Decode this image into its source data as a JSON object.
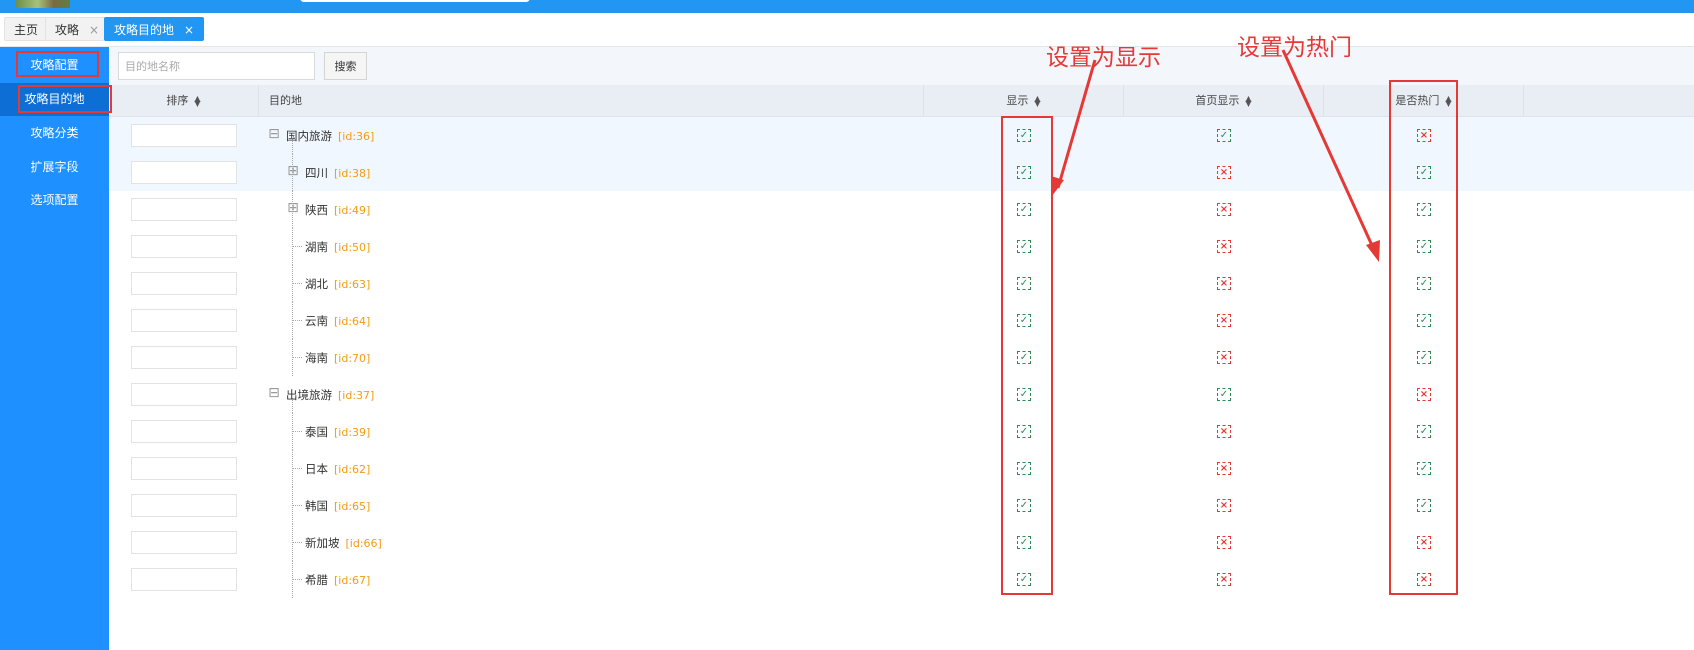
{
  "tabs": [
    {
      "label": "主页",
      "closable": false
    },
    {
      "label": "攻略",
      "closable": true,
      "close": "×"
    },
    {
      "label": "攻略目的地",
      "closable": true,
      "close": "×"
    }
  ],
  "sidebar": {
    "items": [
      {
        "label": "攻略配置"
      },
      {
        "label": "攻略目的地"
      },
      {
        "label": "攻略分类"
      },
      {
        "label": "扩展字段"
      },
      {
        "label": "选项配置"
      }
    ]
  },
  "search": {
    "placeholder": "目的地名称",
    "button_label": "搜索"
  },
  "table": {
    "headers": {
      "order": "排序",
      "destination": "目的地",
      "display": "显示",
      "home_display": "首页显示",
      "hot": "是否热门"
    },
    "rows": [
      {
        "name": "国内旅游",
        "id": "[id:36]",
        "toggle": "⊟",
        "display": true,
        "home": true,
        "hot": false
      },
      {
        "name": "四川",
        "id": "[id:38]",
        "toggle": "⊞",
        "display": true,
        "home": false,
        "hot": true
      },
      {
        "name": "陕西",
        "id": "[id:49]",
        "toggle": "⊞",
        "display": true,
        "home": false,
        "hot": true
      },
      {
        "name": "湖南",
        "id": "[id:50]",
        "display": true,
        "home": false,
        "hot": true
      },
      {
        "name": "湖北",
        "id": "[id:63]",
        "display": true,
        "home": false,
        "hot": true
      },
      {
        "name": "云南",
        "id": "[id:64]",
        "display": true,
        "home": false,
        "hot": true
      },
      {
        "name": "海南",
        "id": "[id:70]",
        "display": true,
        "home": false,
        "hot": true
      },
      {
        "name": "出境旅游",
        "id": "[id:37]",
        "toggle": "⊟",
        "display": true,
        "home": true,
        "hot": false
      },
      {
        "name": "泰国",
        "id": "[id:39]",
        "display": true,
        "home": false,
        "hot": true
      },
      {
        "name": "日本",
        "id": "[id:62]",
        "display": true,
        "home": false,
        "hot": true
      },
      {
        "name": "韩国",
        "id": "[id:65]",
        "display": true,
        "home": false,
        "hot": true
      },
      {
        "name": "新加坡",
        "id": "[id:66]",
        "display": true,
        "home": false,
        "hot": false
      },
      {
        "name": "希腊",
        "id": "[id:67]",
        "display": true,
        "home": false,
        "hot": false
      }
    ]
  },
  "annotations": {
    "show_label": "设置为显示",
    "hot_label": "设置为热门"
  },
  "icons": {
    "checked": "checkbox-checked-icon",
    "unchecked": "checkbox-x-icon"
  },
  "colors": {
    "brand": "#2196f3",
    "sidebar": "#1e90ff",
    "id_text": "#f39c12",
    "check_on": "#2e8b57",
    "check_off": "#e53935",
    "annotation": "#e53935"
  }
}
